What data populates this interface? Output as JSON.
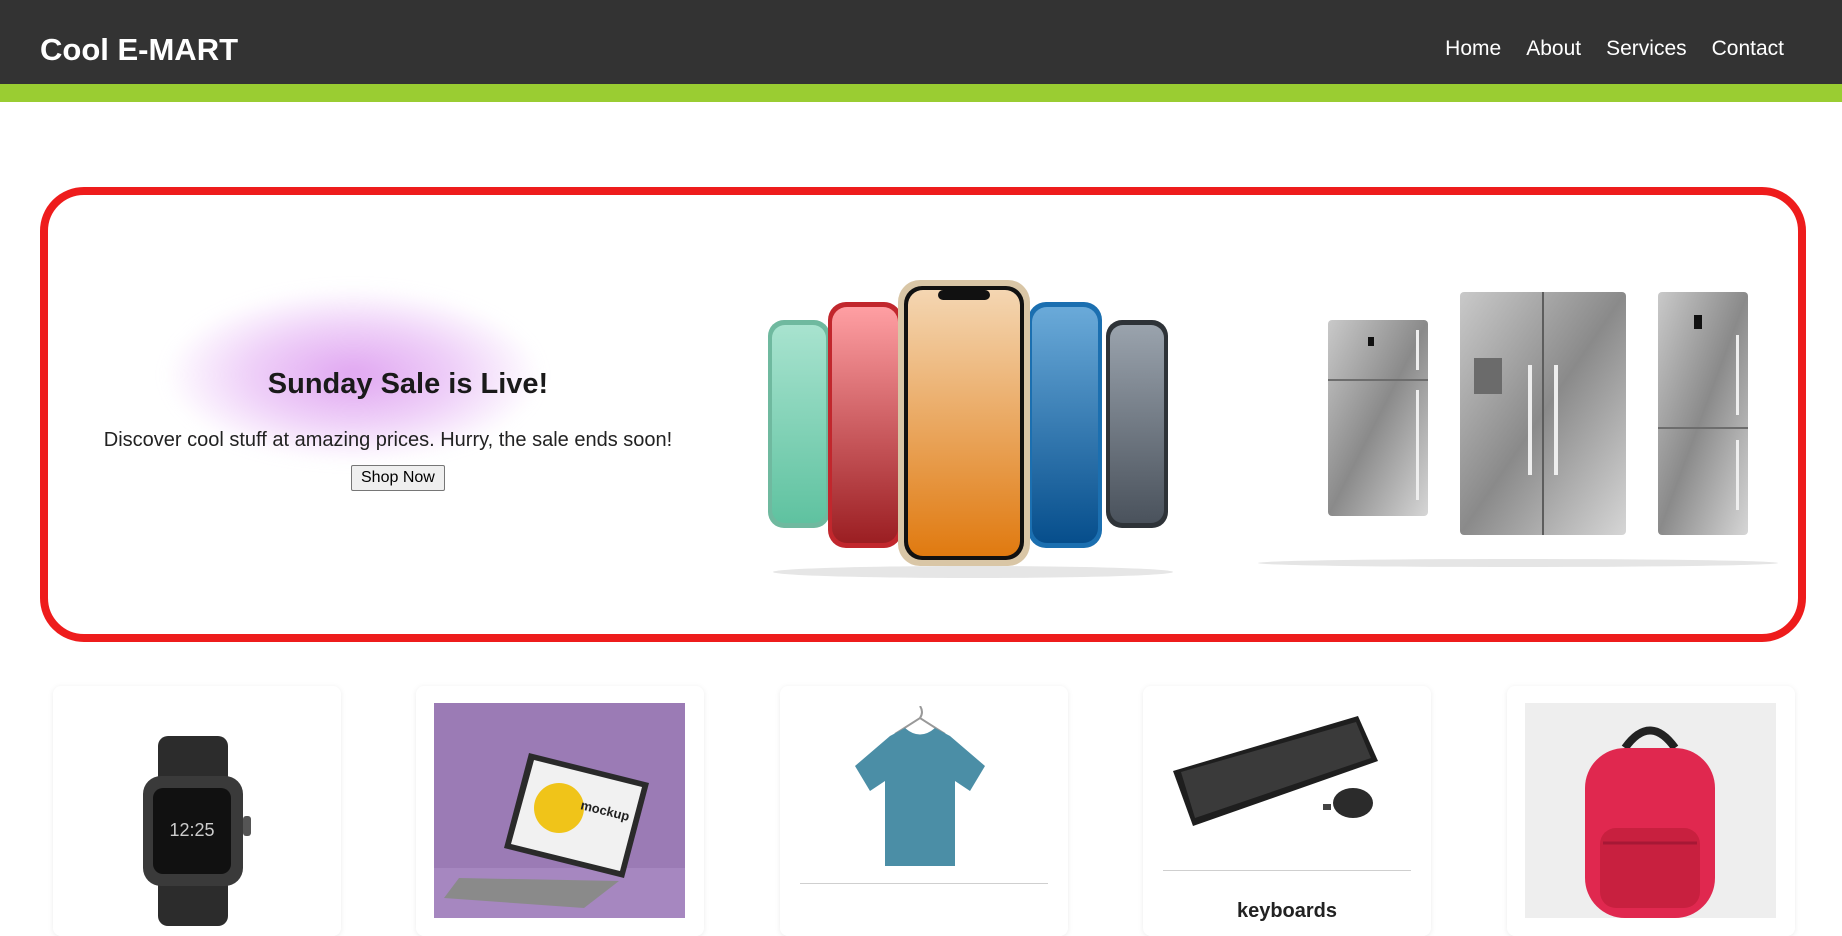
{
  "header": {
    "brand": "Cool E-MART",
    "nav": [
      "Home",
      "About",
      "Services",
      "Contact"
    ]
  },
  "banner": {
    "title": "Sunday Sale is Live!",
    "description": "Discover cool stuff at amazing prices. Hurry, the sale ends soon!",
    "button_label": "Shop Now",
    "images": [
      "phones-image",
      "refrigerators-image"
    ]
  },
  "products": [
    {
      "image": "smartwatch-image",
      "title": ""
    },
    {
      "image": "laptop-image",
      "title": ""
    },
    {
      "image": "tshirt-image",
      "title": ""
    },
    {
      "image": "keyboard-image",
      "title": "keyboards"
    },
    {
      "image": "backpack-image",
      "title": ""
    }
  ],
  "colors": {
    "nav_bg": "#333333",
    "nav_accent": "#9acd32",
    "banner_border": "#ee1c1c"
  }
}
